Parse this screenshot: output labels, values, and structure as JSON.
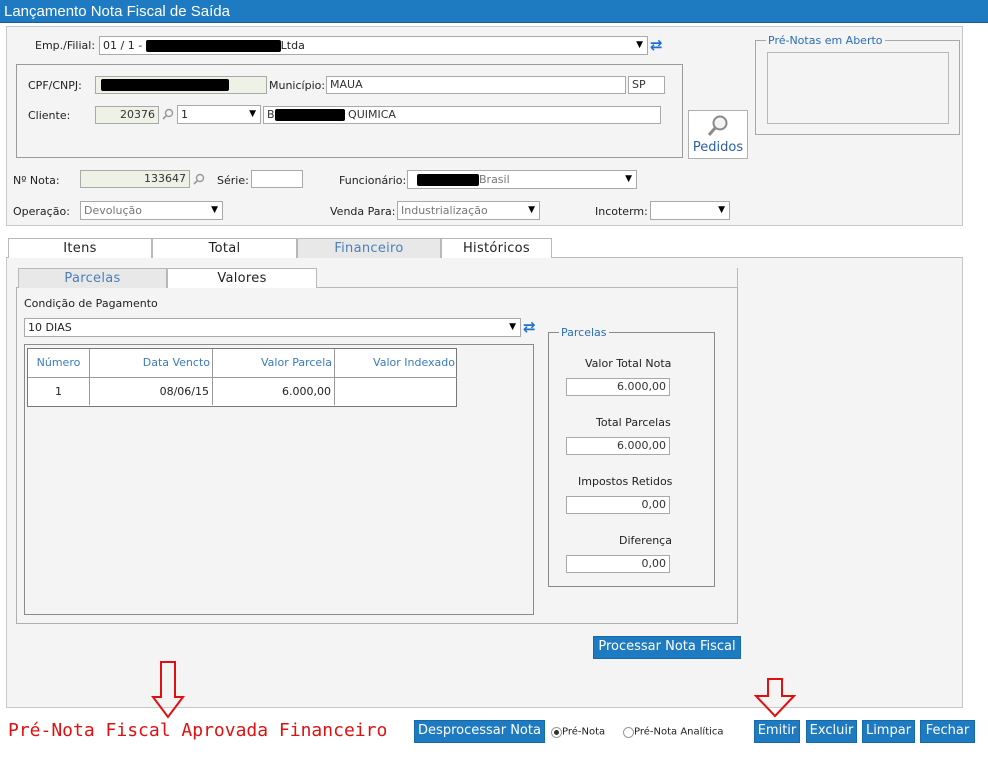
{
  "window": {
    "title": "Lançamento Nota Fiscal de Saída"
  },
  "header": {
    "emp_filial_label": "Emp./Filial:",
    "emp_filial_value_prefix": "01 / 1 -",
    "emp_filial_value_suffix": "Ltda",
    "cpf_cnpj_label": "CPF/CNPJ:",
    "municipio_label": "Município:",
    "municipio_value": "MAUA",
    "uf_value": "SP",
    "cliente_label": "Cliente:",
    "cliente_code": "20376",
    "cliente_loja": "1",
    "cliente_name_prefix": "B",
    "cliente_name_suffix": "QUIMICA",
    "pedidos_label": "Pedidos",
    "pre_notas_label": "Pré-Notas em Aberto",
    "nota_label": "Nº Nota:",
    "nota_value": "133647",
    "serie_label": "Série:",
    "serie_value": "",
    "funcionario_label": "Funcionário:",
    "funcionario_suffix": "Brasil",
    "operacao_label": "Operação:",
    "operacao_value": "Devolução",
    "venda_para_label": "Venda Para:",
    "venda_para_value": "Industrialização",
    "incoterm_label": "Incoterm:",
    "incoterm_value": ""
  },
  "tabs": [
    "Itens",
    "Total",
    "Financeiro",
    "Históricos"
  ],
  "subtabs": [
    "Parcelas",
    "Valores"
  ],
  "payment": {
    "condicao_label": "Condição de Pagamento",
    "condicao_value": "10 DIAS",
    "grid_headers": [
      "Número",
      "Data Vencto",
      "Valor Parcela",
      "Valor Indexado"
    ],
    "grid_rows": [
      [
        "1",
        "08/06/15",
        "6.000,00",
        ""
      ]
    ]
  },
  "parcelas_box": {
    "legend": "Parcelas",
    "valor_total_label": "Valor Total Nota",
    "valor_total_value": "6.000,00",
    "total_parcelas_label": "Total Parcelas",
    "total_parcelas_value": "6.000,00",
    "impostos_label": "Impostos Retidos",
    "impostos_value": "0,00",
    "diferenca_label": "Diferença",
    "diferenca_value": "0,00"
  },
  "actions": {
    "processar": "Processar Nota Fiscal",
    "desprocessar": "Desprocessar Nota",
    "radio_pre_nota": "Pré-Nota",
    "radio_pre_nota_analitica": "Pré-Nota Analítica",
    "emitir": "Emitir",
    "excluir": "Excluir",
    "limpar": "Limpar",
    "fechar": "Fechar"
  },
  "annotation": {
    "text": "Pré-Nota Fiscal Aprovada Financeiro",
    "color": "#e01010"
  },
  "colors": {
    "accent": "#1e7bc1",
    "annotation": "#e01010"
  }
}
